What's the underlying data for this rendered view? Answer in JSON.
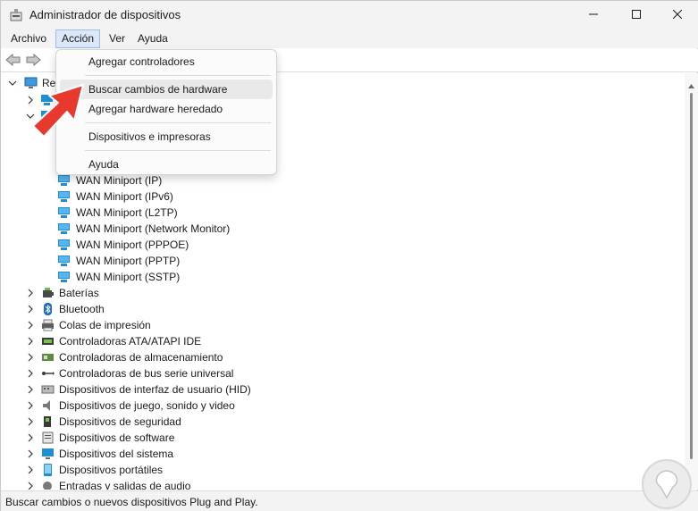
{
  "window": {
    "title": "Administrador de dispositivos"
  },
  "menubar": {
    "items": [
      "Archivo",
      "Acción",
      "Ver",
      "Ayuda"
    ]
  },
  "action_menu": {
    "items": [
      {
        "label": "Agregar controladores"
      },
      {
        "label": "Buscar cambios de hardware"
      },
      {
        "label": "Agregar hardware heredado"
      },
      {
        "label": "Dispositivos e impresoras"
      },
      {
        "label": "Ayuda"
      }
    ]
  },
  "tree": {
    "root_label": "Re",
    "network_adapters": [
      "WAN Miniport (IP)",
      "WAN Miniport (IPv6)",
      "WAN Miniport (L2TP)",
      "WAN Miniport (Network Monitor)",
      "WAN Miniport (PPPOE)",
      "WAN Miniport (PPTP)",
      "WAN Miniport (SSTP)"
    ],
    "categories": [
      "Baterías",
      "Bluetooth",
      "Colas de impresión",
      "Controladoras ATA/ATAPI IDE",
      "Controladoras de almacenamiento",
      "Controladoras de bus serie universal",
      "Dispositivos de interfaz de usuario (HID)",
      "Dispositivos de juego, sonido y video",
      "Dispositivos de seguridad",
      "Dispositivos de software",
      "Dispositivos del sistema",
      "Dispositivos portátiles",
      "Entradas y salidas de audio"
    ]
  },
  "statusbar": {
    "text": "Buscar cambios o nuevos dispositivos Plug and Play."
  },
  "icons": {
    "app": "device-manager-icon",
    "minimize": "minimize-icon",
    "maximize": "maximize-icon",
    "close": "close-icon",
    "back": "back-arrow-icon",
    "forward": "forward-arrow-icon",
    "network_adapter": "network-adapter-icon"
  },
  "colors": {
    "pointer": "#e8392f",
    "menu_active": "#dce8f7",
    "network_icon": "#1f8fd1"
  }
}
